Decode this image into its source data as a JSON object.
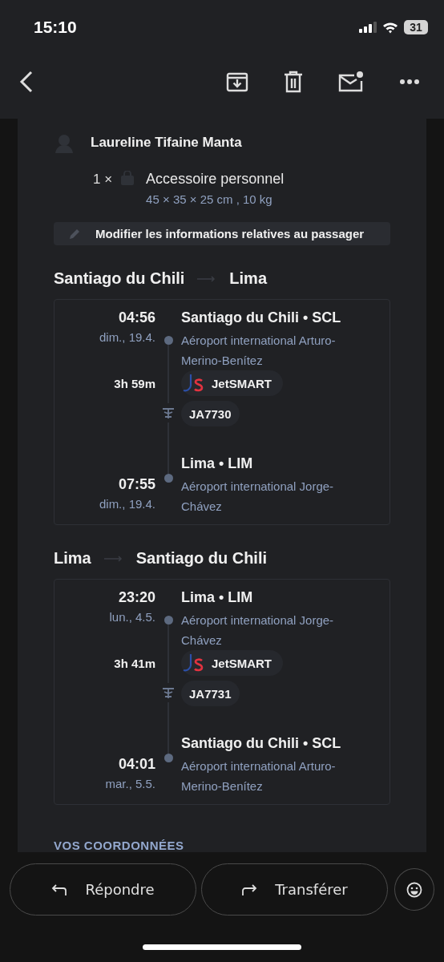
{
  "status_bar": {
    "time": "15:10",
    "battery": "31"
  },
  "passenger": {
    "name": "Laureline Tifaine Manta",
    "quantity": "1 ×",
    "baggage": "Accessoire personnel",
    "dimensions": "45 × 35 × 25 cm , 10 kg",
    "edit_button": "Modifier les informations relatives au passager"
  },
  "flights": [
    {
      "from": "Santiago du Chili",
      "to": "Lima",
      "departure": {
        "time": "04:56",
        "date": "dim., 19.4.",
        "place": "Santiago du Chili • SCL",
        "airport": "Aéroport international Arturo-Merino-Benítez"
      },
      "duration": "3h 59m",
      "airline": "JetSMART",
      "flight_number": "JA7730",
      "arrival": {
        "time": "07:55",
        "date": "dim., 19.4.",
        "place": "Lima • LIM",
        "airport": "Aéroport international Jorge-Chávez"
      }
    },
    {
      "from": "Lima",
      "to": "Santiago du Chili",
      "departure": {
        "time": "23:20",
        "date": "lun., 4.5.",
        "place": "Lima • LIM",
        "airport": "Aéroport international Jorge-Chávez"
      },
      "duration": "3h 41m",
      "airline": "JetSMART",
      "flight_number": "JA7731",
      "arrival": {
        "time": "04:01",
        "date": "mar., 5.5.",
        "place": "Santiago du Chili • SCL",
        "airport": "Aéroport international Arturo-Merino-Benítez"
      }
    }
  ],
  "section_heading": "VOS COORDONNÉES",
  "actions": [
    {
      "label": "Répondre",
      "kind": "reply"
    },
    {
      "label": "Transférer",
      "kind": "forward"
    }
  ]
}
